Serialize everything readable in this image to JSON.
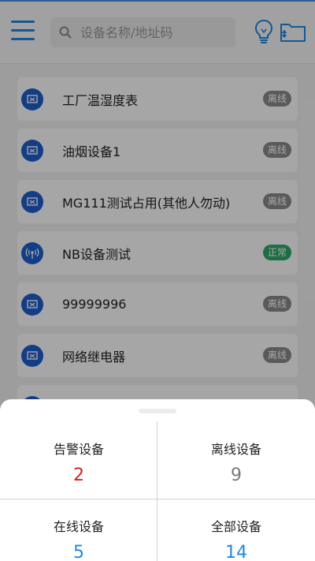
{
  "header": {
    "search_placeholder": "设备名称/地址码"
  },
  "devices": [
    {
      "name": "工厂温湿度表",
      "status": "离线",
      "icon": "device-screen-icon"
    },
    {
      "name": "油烟设备1",
      "status": "离线",
      "icon": "device-screen-icon"
    },
    {
      "name": "MG111测试占用(其他人勿动)",
      "status": "离线",
      "icon": "device-screen-icon"
    },
    {
      "name": "NB设备测试",
      "status": "正常",
      "icon": "antenna-icon"
    },
    {
      "name": "99999996",
      "status": "离线",
      "icon": "device-screen-icon"
    },
    {
      "name": "网络继电器",
      "status": "离线",
      "icon": "device-screen-icon"
    }
  ],
  "summary": {
    "alarm": {
      "label": "告警设备",
      "value": "2",
      "color": "#d81e1e"
    },
    "offline": {
      "label": "离线设备",
      "value": "9",
      "color": "#7a7a7a"
    },
    "online": {
      "label": "在线设备",
      "value": "5",
      "color": "#1e88e5"
    },
    "all": {
      "label": "全部设备",
      "value": "14",
      "color": "#1e88e5"
    }
  },
  "colors": {
    "accent": "#1e88e5",
    "online_badge": "#2eaa6a",
    "offline_badge": "#8a8a8a",
    "alarm": "#d81e1e"
  }
}
